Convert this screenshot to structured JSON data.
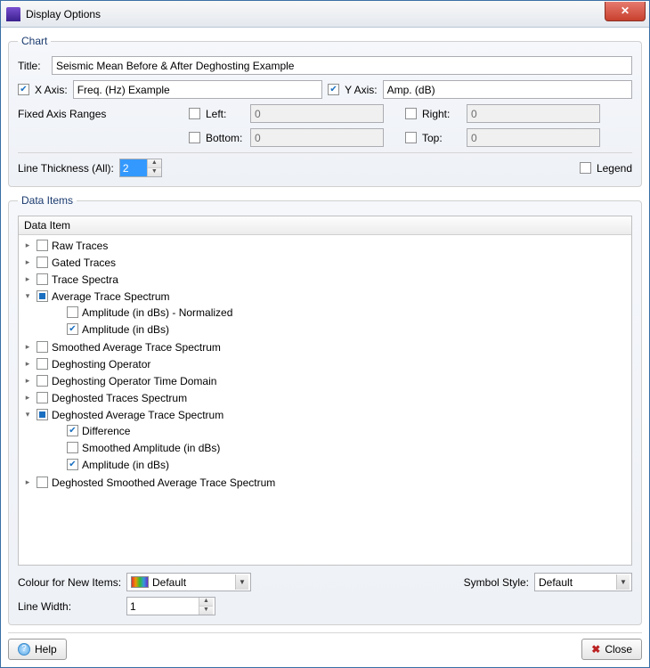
{
  "window": {
    "title": "Display Options"
  },
  "chart": {
    "legend": "Chart",
    "title_label": "Title:",
    "title_value": "Seismic Mean Before & After Deghosting Example",
    "xaxis_label": "X Axis:",
    "xaxis_value": "Freq. (Hz) Example",
    "yaxis_label": "Y Axis:",
    "yaxis_value": "Amp. (dB)",
    "fixed_label": "Fixed Axis Ranges",
    "left_label": "Left:",
    "left_value": "0",
    "right_label": "Right:",
    "right_value": "0",
    "bottom_label": "Bottom:",
    "bottom_value": "0",
    "top_label": "Top:",
    "top_value": "0",
    "linethick_label": "Line Thickness (All):",
    "linethick_value": "2",
    "legend_label": "Legend"
  },
  "dataitems": {
    "legend": "Data Items",
    "header": "Data Item",
    "nodes": [
      {
        "label": "Raw Traces",
        "state": "unchecked",
        "expandable": true,
        "expanded": false
      },
      {
        "label": "Gated Traces",
        "state": "unchecked",
        "expandable": true,
        "expanded": false
      },
      {
        "label": "Trace Spectra",
        "state": "unchecked",
        "expandable": true,
        "expanded": false
      },
      {
        "label": "Average Trace Spectrum",
        "state": "partial",
        "expandable": true,
        "expanded": true,
        "children": [
          {
            "label": "Amplitude (in dBs) - Normalized",
            "state": "unchecked"
          },
          {
            "label": "Amplitude (in dBs)",
            "state": "checked"
          }
        ]
      },
      {
        "label": "Smoothed Average Trace Spectrum",
        "state": "unchecked",
        "expandable": true,
        "expanded": false
      },
      {
        "label": "Deghosting Operator",
        "state": "unchecked",
        "expandable": true,
        "expanded": false
      },
      {
        "label": "Deghosting Operator Time Domain",
        "state": "unchecked",
        "expandable": true,
        "expanded": false
      },
      {
        "label": "Deghosted Traces Spectrum",
        "state": "unchecked",
        "expandable": true,
        "expanded": false
      },
      {
        "label": "Deghosted Average Trace Spectrum",
        "state": "partial",
        "expandable": true,
        "expanded": true,
        "children": [
          {
            "label": "Difference",
            "state": "checked"
          },
          {
            "label": "Smoothed Amplitude (in dBs)",
            "state": "unchecked"
          },
          {
            "label": "Amplitude (in dBs)",
            "state": "checked"
          }
        ]
      },
      {
        "label": "Deghosted Smoothed Average Trace Spectrum",
        "state": "unchecked",
        "expandable": true,
        "expanded": false
      }
    ],
    "colour_label": "Colour for New Items:",
    "colour_value": "Default",
    "symbol_label": "Symbol Style:",
    "symbol_value": "Default",
    "linewidth_label": "Line Width:",
    "linewidth_value": "1"
  },
  "buttons": {
    "help": "Help",
    "close": "Close"
  }
}
